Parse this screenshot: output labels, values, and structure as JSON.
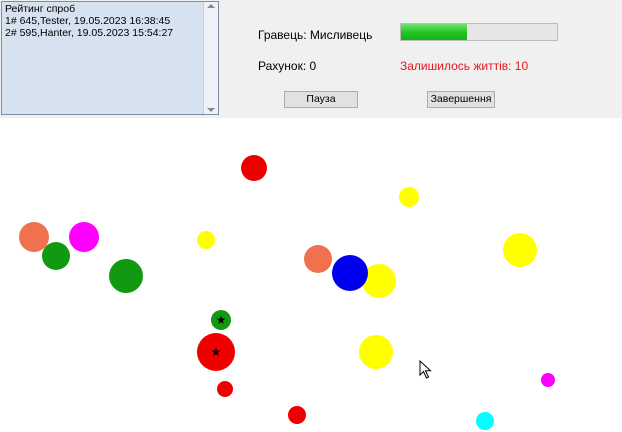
{
  "ranking": {
    "lines": [
      "Рейтинг спроб",
      "1# 645,Tester, 19.05.2023 16:38:45",
      "2# 595,Hanter, 19.05.2023 15:54:27"
    ]
  },
  "status": {
    "player_label": "Гравець: Мисливець",
    "score_label": "Рахунок: 0",
    "lives_label": "Залишилось життів: 10",
    "progress": 0.42
  },
  "buttons": {
    "pause": "Пауза",
    "finish": "Завершення"
  },
  "balls": [
    {
      "color": "#ee0000",
      "marked": false
    },
    {
      "color": "#ffff00",
      "marked": false
    },
    {
      "color": "#f07050",
      "marked": false
    },
    {
      "color": "#ff00ff",
      "marked": false
    },
    {
      "color": "#119911",
      "marked": false
    },
    {
      "color": "#119911",
      "marked": false
    },
    {
      "color": "#ffff00",
      "marked": false
    },
    {
      "color": "#ffff00",
      "marked": false
    },
    {
      "color": "#f07050",
      "marked": false
    },
    {
      "color": "#ffff00",
      "marked": false
    },
    {
      "color": "#0000ee",
      "marked": false
    },
    {
      "color": "#119911",
      "marked": true
    },
    {
      "color": "#ee0000",
      "marked": true
    },
    {
      "color": "#ffff00",
      "marked": false
    },
    {
      "color": "#ee0000",
      "marked": false
    },
    {
      "color": "#ff00ff",
      "marked": false
    },
    {
      "color": "#ee0000",
      "marked": false
    },
    {
      "color": "#00ffff",
      "marked": false
    }
  ],
  "star_symbol": "★"
}
